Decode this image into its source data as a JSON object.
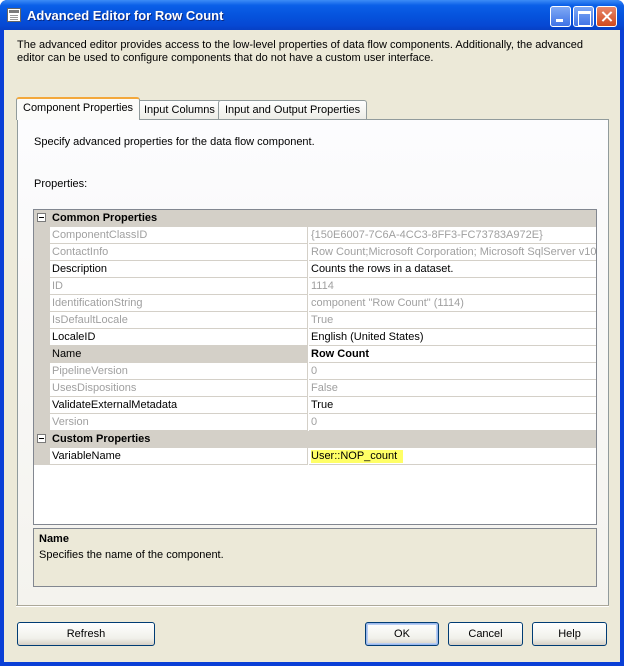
{
  "window": {
    "title": "Advanced Editor for Row Count"
  },
  "description": "The advanced editor provides access to the low-level properties of data flow components. Additionally, the advanced editor can be used to configure components that do not have a custom user interface.",
  "tabs": [
    {
      "label": "Component Properties",
      "active": true
    },
    {
      "label": "Input Columns",
      "active": false
    },
    {
      "label": "Input and Output Properties",
      "active": false
    }
  ],
  "panel": {
    "hint": "Specify advanced properties for the data flow component.",
    "properties_label": "Properties:"
  },
  "categories": [
    {
      "name": "Common Properties",
      "rows": [
        {
          "name": "ComponentClassID",
          "value": "{150E6007-7C6A-4CC3-8FF3-FC73783A972E}",
          "readonly": true
        },
        {
          "name": "ContactInfo",
          "value": "Row Count;Microsoft Corporation; Microsoft SqlServer v10;",
          "readonly": true
        },
        {
          "name": "Description",
          "value": "Counts the rows in a dataset.",
          "readonly": false
        },
        {
          "name": "ID",
          "value": "1114",
          "readonly": true
        },
        {
          "name": "IdentificationString",
          "value": "component \"Row Count\" (1114)",
          "readonly": true
        },
        {
          "name": "IsDefaultLocale",
          "value": "True",
          "readonly": true
        },
        {
          "name": "LocaleID",
          "value": "English (United States)",
          "readonly": false
        },
        {
          "name": "Name",
          "value": "Row Count",
          "readonly": false,
          "selected": true
        },
        {
          "name": "PipelineVersion",
          "value": "0",
          "readonly": true
        },
        {
          "name": "UsesDispositions",
          "value": "False",
          "readonly": true
        },
        {
          "name": "ValidateExternalMetadata",
          "value": "True",
          "readonly": false
        },
        {
          "name": "Version",
          "value": "0",
          "readonly": true
        }
      ]
    },
    {
      "name": "Custom Properties",
      "rows": [
        {
          "name": "VariableName",
          "value": "User::NOP_count",
          "readonly": false,
          "highlight": true
        }
      ]
    }
  ],
  "help": {
    "title": "Name",
    "text": "Specifies the name of the component."
  },
  "buttons": {
    "refresh": "Refresh",
    "ok": "OK",
    "cancel": "Cancel",
    "help": "Help"
  },
  "colors": {
    "title_bar": "#0552dc",
    "highlight": "#ffff66",
    "readonly_text": "#a0a0a0",
    "tab_accent": "#f3a83c"
  }
}
